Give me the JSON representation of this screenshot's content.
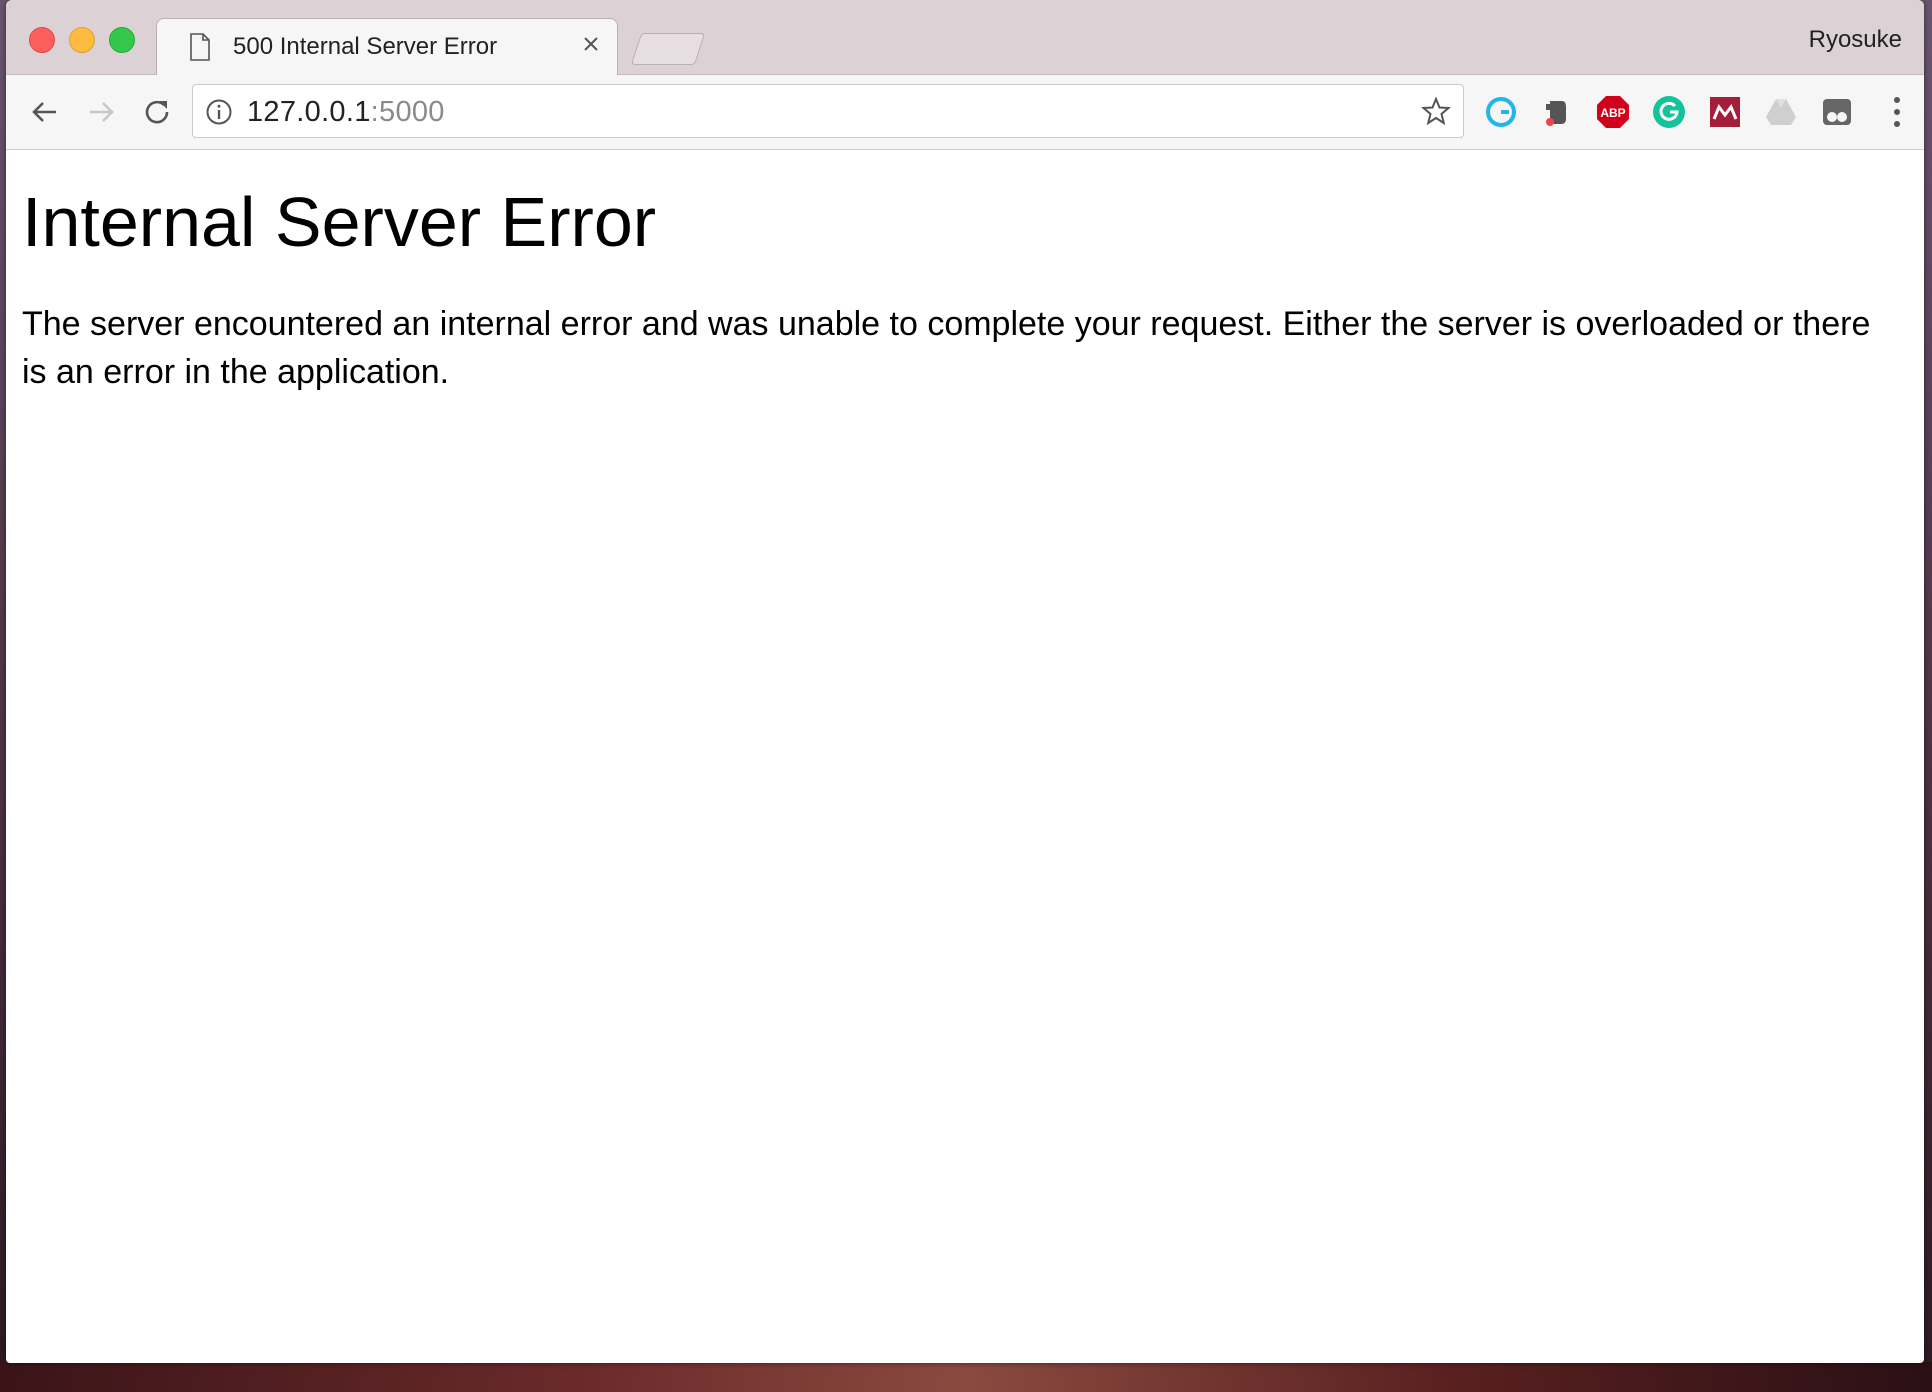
{
  "window": {
    "profile_name": "Ryosuke"
  },
  "tab": {
    "title": "500 Internal Server Error",
    "close_glyph": "×"
  },
  "address_bar": {
    "host": "127.0.0.1",
    "port": ":5000"
  },
  "extensions": [
    {
      "name": "grammarly-icon"
    },
    {
      "name": "evernote-icon"
    },
    {
      "name": "adblock-plus-icon",
      "label": "ABP"
    },
    {
      "name": "grammarly-green-icon"
    },
    {
      "name": "mendeley-icon"
    },
    {
      "name": "google-drive-icon"
    },
    {
      "name": "incognito-icon"
    }
  ],
  "page": {
    "heading": "Internal Server Error",
    "body": "The server encountered an internal error and was unable to complete your request. Either the server is overloaded or there is an error in the application."
  },
  "colors": {
    "close": "#fc605c",
    "minimize": "#fdbc40",
    "zoom": "#34c84a",
    "abp": "#d0021b",
    "grammarly_green": "#15c39a",
    "grammarly_blue": "#24b4e8",
    "mendeley": "#a41d3a"
  }
}
